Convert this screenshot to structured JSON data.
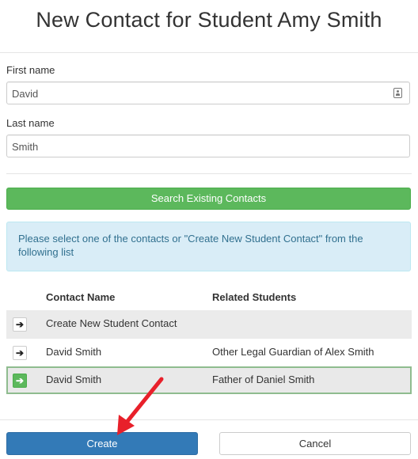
{
  "title": "New Contact for Student Amy Smith",
  "form": {
    "first_name_label": "First name",
    "first_name_value": "David",
    "last_name_label": "Last name",
    "last_name_value": "Smith"
  },
  "search_button": "Search Existing Contacts",
  "info_text": "Please select one of the contacts or \"Create New Student Contact\" from the following list",
  "table": {
    "headers": [
      "Contact Name",
      "Related Students"
    ],
    "rows": [
      {
        "name": "Create New Student Contact",
        "related": ""
      },
      {
        "name": "David Smith",
        "related": "Other Legal Guardian of Alex Smith"
      },
      {
        "name": "David Smith",
        "related": "Father of Daniel Smith"
      }
    ]
  },
  "buttons": {
    "create": "Create",
    "cancel": "Cancel"
  },
  "colors": {
    "success": "#5cb85c",
    "primary": "#337ab7",
    "info_bg": "#d9edf7",
    "info_text": "#31708f",
    "annotation_arrow": "#e8202a"
  }
}
